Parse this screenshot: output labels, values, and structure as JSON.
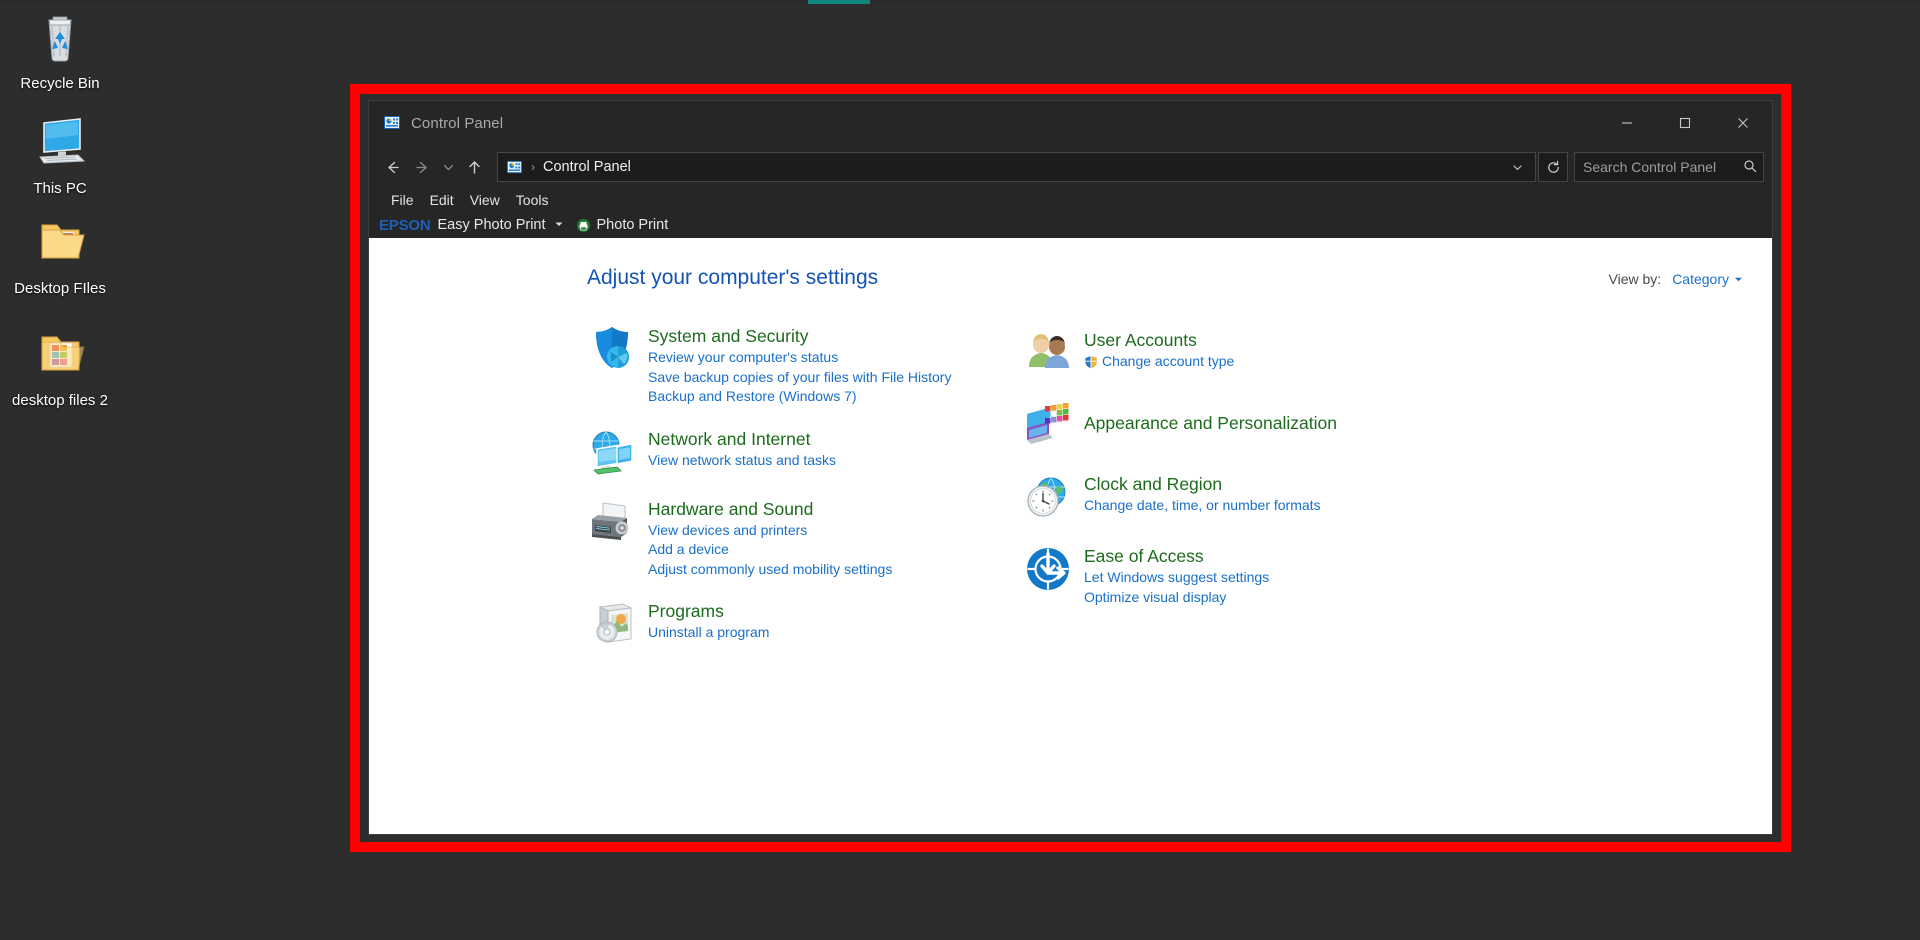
{
  "desktop": {
    "icons": [
      {
        "name": "recycle-bin",
        "label": "Recycle Bin",
        "icon": "recycle-bin-icon"
      },
      {
        "name": "this-pc",
        "label": "This PC",
        "icon": "computer-icon"
      },
      {
        "name": "desktop-files",
        "label": "Desktop FIles",
        "icon": "folder-icon"
      },
      {
        "name": "desktop-files-2",
        "label": "desktop files 2",
        "icon": "folder-icon"
      }
    ]
  },
  "window": {
    "title": "Control Panel",
    "title_icon": "control-panel-icon",
    "controls": {
      "minimize": "–",
      "maximize": "□",
      "close": "✕"
    }
  },
  "nav": {
    "back": "←",
    "forward": "→",
    "recent": "∨",
    "up": "↑",
    "address_icon": "control-panel-icon",
    "address_separator": "›",
    "address_text": "Control Panel",
    "address_dropdown": "⌄",
    "refresh": "↻"
  },
  "search": {
    "placeholder": "Search Control Panel",
    "icon": "search-icon"
  },
  "menu": {
    "items": [
      "File",
      "Edit",
      "View",
      "Tools"
    ]
  },
  "epson_toolbar": {
    "logo": "EPSON",
    "label": "Easy Photo Print",
    "caret": "▾",
    "photo_print": "Photo Print",
    "photo_print_icon": "epson-print-icon"
  },
  "main": {
    "heading": "Adjust your computer's settings",
    "view_by": {
      "label": "View by:",
      "value": "Category",
      "caret": "▾"
    },
    "left_categories": [
      {
        "id": "system-and-security",
        "title": "System and Security",
        "icon": "shield-security-icon",
        "links": [
          "Review your computer's status",
          "Save backup copies of your files with File History",
          "Backup and Restore (Windows 7)"
        ]
      },
      {
        "id": "network-and-internet",
        "title": "Network and Internet",
        "icon": "network-globe-icon",
        "links": [
          "View network status and tasks"
        ]
      },
      {
        "id": "hardware-and-sound",
        "title": "Hardware and Sound",
        "icon": "printer-icon",
        "links": [
          "View devices and printers",
          "Add a device",
          "Adjust commonly used mobility settings"
        ]
      },
      {
        "id": "programs",
        "title": "Programs",
        "icon": "programs-box-icon",
        "links": [
          "Uninstall a program"
        ]
      }
    ],
    "right_categories": [
      {
        "id": "user-accounts",
        "title": "User Accounts",
        "icon": "user-accounts-icon",
        "links": [
          "Change account type"
        ],
        "shield_on_first_link": true
      },
      {
        "id": "appearance-and-personalization",
        "title": "Appearance and Personalization",
        "icon": "appearance-icon",
        "links": []
      },
      {
        "id": "clock-and-region",
        "title": "Clock and Region",
        "icon": "clock-region-icon",
        "links": [
          "Change date, time, or number formats"
        ]
      },
      {
        "id": "ease-of-access",
        "title": "Ease of Access",
        "icon": "ease-of-access-icon",
        "links": [
          "Let Windows suggest settings",
          "Optimize visual display"
        ]
      }
    ]
  },
  "colors": {
    "highlight_frame": "#ff0000",
    "desktop_bg": "#2d2d2d",
    "window_chrome": "#262626",
    "category_title": "#1d6b1d",
    "link": "#1a70c9",
    "heading": "#1353b5",
    "epson_blue": "#1c5fb8",
    "taskbar_accent": "#11867f"
  }
}
